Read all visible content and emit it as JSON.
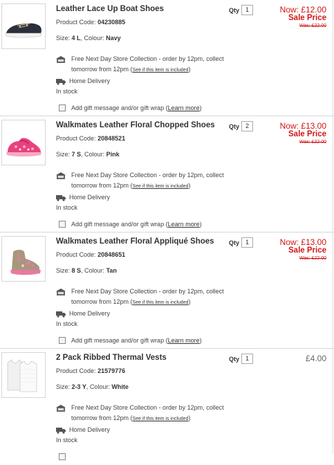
{
  "common": {
    "qty_label": "Qty",
    "collect_line1": "Free Next Day Store Collection - order by 12pm, collect",
    "collect_line2": "tomorrow from 12pm (",
    "collect_link": "See if this item is included",
    "collect_close": ")",
    "home_delivery": "Home Delivery",
    "in_stock": "In stock",
    "gift_text": "Add gift message and/or gift wrap (",
    "gift_link": "Learn more",
    "gift_close": ")",
    "product_code_label": "Product Code:",
    "size_label": "Size:",
    "colour_label": ", Colour:",
    "store_icon": "store-collection-icon",
    "van_icon": "delivery-van-icon"
  },
  "items": [
    {
      "title": "Leather Lace Up Boat Shoes",
      "code": "04230885",
      "size": "4 L",
      "colour": "Navy",
      "qty": "1",
      "now": "Now: £12.00",
      "sale": "Sale Price",
      "was": "Was: £22.00",
      "image": "navy-boat-shoe",
      "colors": {
        "main": "#2b2f3c",
        "sole": "#f2f2f2"
      }
    },
    {
      "title": "Walkmates Leather Floral Chopped Shoes",
      "code": "20848521",
      "size": "7 S",
      "colour": "Pink",
      "qty": "2",
      "now": "Now: £13.00",
      "sale": "Sale Price",
      "was": "Was: £22.00",
      "image": "pink-floral-shoe",
      "colors": {
        "main": "#e8417e",
        "sole": "#f7a8c4"
      }
    },
    {
      "title": "Walkmates Leather Floral Appliqué Shoes",
      "code": "20848651",
      "size": "8 S",
      "colour": "Tan",
      "qty": "1",
      "now": "Now: £13.00",
      "sale": "Sale Price",
      "was": "Was: £22.00",
      "image": "tan-floral-boot",
      "colors": {
        "main": "#a7977c",
        "sole": "#e87aa0"
      }
    },
    {
      "title": "2 Pack Ribbed Thermal Vests",
      "code": "21579776",
      "size": "2-3 Y",
      "colour": "White",
      "qty": "1",
      "price": "£4.00",
      "image": "white-thermal-vests",
      "colors": {
        "main": "#f6f6f6",
        "sole": "#dddddd"
      }
    }
  ],
  "colors": {
    "sale_red": "#d11515",
    "divider": "#d8d8d8",
    "text": "#333333"
  }
}
